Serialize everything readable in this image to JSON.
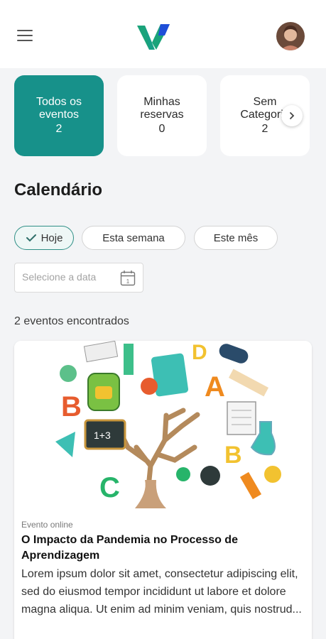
{
  "header": {
    "menu_icon": "hamburger-icon",
    "logo": "brand-v-logo",
    "avatar": "user-avatar"
  },
  "categories": [
    {
      "label": "Todos os eventos",
      "count": "2",
      "active": true
    },
    {
      "label": "Minhas reservas",
      "count": "0",
      "active": false
    },
    {
      "label": "Sem Categoria",
      "count": "2",
      "active": false
    }
  ],
  "section_title": "Calendário",
  "filters": {
    "today": "Hoje",
    "this_week": "Esta semana",
    "this_month": "Este mês"
  },
  "date_picker": {
    "placeholder": "Selecione a data"
  },
  "results_text": "2 eventos encontrados",
  "event": {
    "type": "Evento online",
    "title": "O Impacto da Pandemia no Processo de Aprendizagem",
    "description": "Lorem ipsum dolor sit amet, consectetur adipiscing elit, sed do eiusmod tempor incididunt ut labore et dolore magna aliqua. Ut enim ad minim veniam, quis nostrud..."
  },
  "colors": {
    "accent": "#17918a",
    "logo_green": "#1aa37a",
    "logo_blue": "#1f4fd8"
  }
}
